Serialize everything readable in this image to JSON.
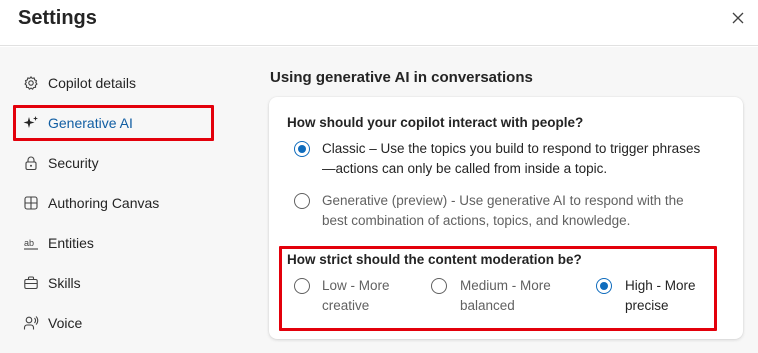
{
  "header": {
    "title": "Settings"
  },
  "sidebar": {
    "items": [
      {
        "label": "Copilot details",
        "icon": "gear-icon"
      },
      {
        "label": "Generative AI",
        "icon": "sparkle-icon",
        "active": true
      },
      {
        "label": "Security",
        "icon": "lock-icon"
      },
      {
        "label": "Authoring Canvas",
        "icon": "grid-icon"
      },
      {
        "label": "Entities",
        "icon": "text-ab-icon"
      },
      {
        "label": "Skills",
        "icon": "briefcase-icon"
      },
      {
        "label": "Voice",
        "icon": "person-voice-icon"
      }
    ]
  },
  "main": {
    "section_title": "Using generative AI in conversations",
    "interact": {
      "question": "How should your copilot interact with people?",
      "options": [
        {
          "line1": "Classic – Use the topics you build to respond to trigger phrases",
          "line2": "—actions can only be called from inside a topic.",
          "selected": true
        },
        {
          "line1": "Generative (preview) - Use generative AI to respond with the",
          "line2": "best combination of actions, topics, and knowledge.",
          "selected": false
        }
      ]
    },
    "moderation": {
      "question": "How strict should the content moderation be?",
      "options": [
        {
          "line1": "Low - More",
          "line2": "creative",
          "selected": false
        },
        {
          "line1": "Medium - More",
          "line2": "balanced",
          "selected": false
        },
        {
          "line1": "High - More",
          "line2": "precise",
          "selected": true
        }
      ]
    }
  },
  "colors": {
    "accent": "#0f6cbd",
    "highlight": "#e3000b",
    "active_nav": "#115ea3"
  }
}
